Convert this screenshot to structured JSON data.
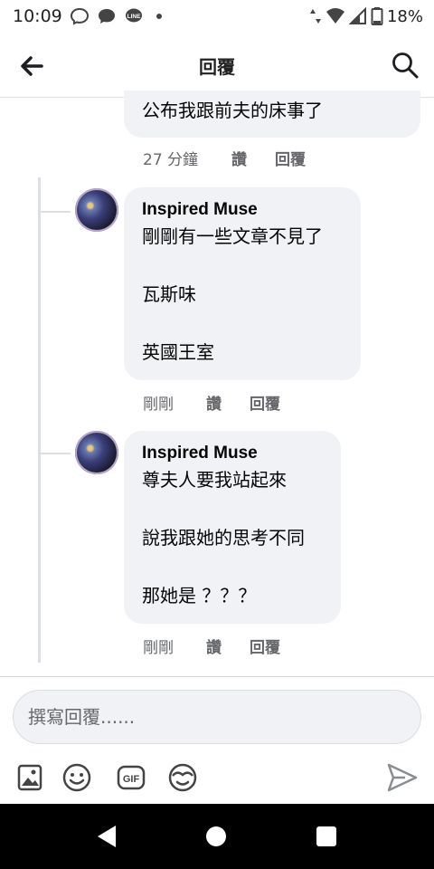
{
  "status_bar": {
    "time": "10:09",
    "battery": "18%"
  },
  "header": {
    "title": "回覆"
  },
  "parent_comment": {
    "text": "公布我跟前夫的床事了",
    "time": "27 分鐘",
    "like_label": "讚",
    "reply_label": "回覆"
  },
  "replies": [
    {
      "author": "Inspired Muse",
      "lines": [
        "剛剛有一些文章不見了",
        "",
        "瓦斯味",
        "",
        "英國王室"
      ],
      "time": "剛剛",
      "like_label": "讚",
      "reply_label": "回覆"
    },
    {
      "author": "Inspired Muse",
      "lines": [
        "尊夫人要我站起來",
        "",
        "說我跟她的思考不同",
        "",
        "那她是 ？？？"
      ],
      "time": "剛剛",
      "like_label": "讚",
      "reply_label": "回覆"
    }
  ],
  "composer": {
    "placeholder": "撰寫回覆......"
  },
  "toolbar_icons": [
    "photo-icon",
    "emoji-icon",
    "gif-icon",
    "sticker-icon",
    "send-icon"
  ]
}
